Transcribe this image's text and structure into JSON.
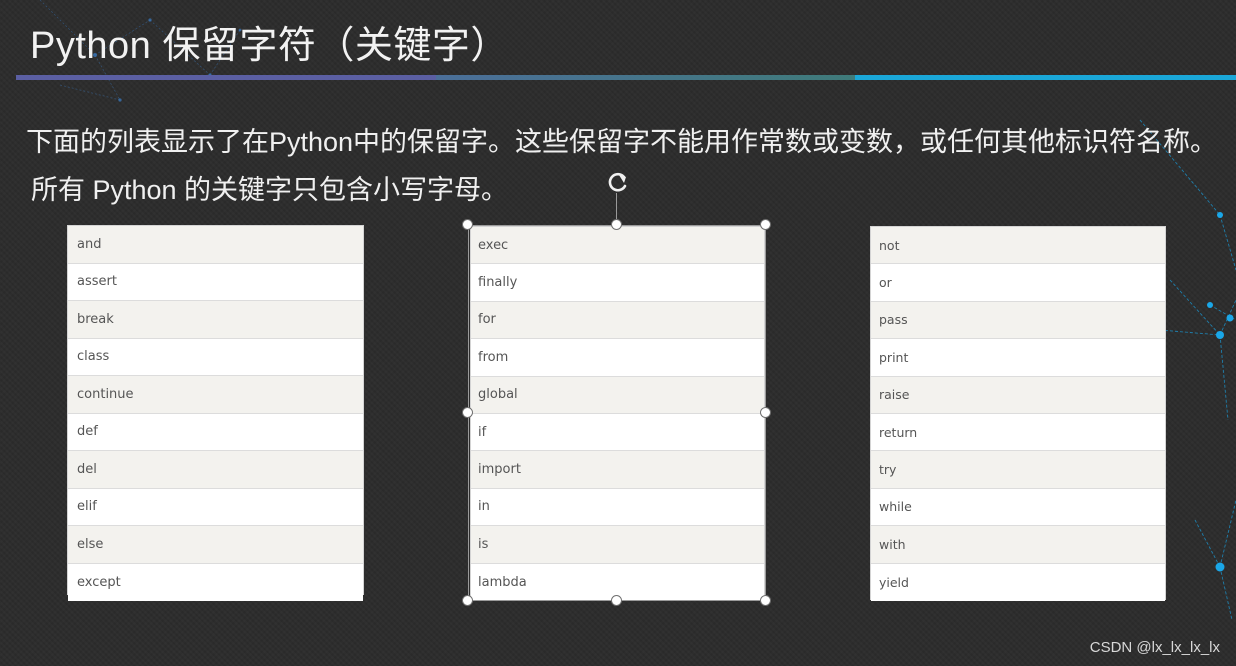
{
  "slide": {
    "title": "Python 保留字符（关键字）",
    "description_line1": "下面的列表显示了在Python中的保留字。这些保留字不能用作常数或变数，或任何其他标识符名称。",
    "description_line2": "所有 Python 的关键字只包含小写字母。"
  },
  "tables": {
    "column1": [
      "and",
      "assert",
      "break",
      "class",
      "continue",
      "def",
      "del",
      "elif",
      "else",
      "except"
    ],
    "column2": [
      "exec",
      "finally",
      "for",
      "from",
      "global",
      "if",
      "import",
      "in",
      "is",
      "lambda"
    ],
    "column3": [
      "not",
      "or",
      "pass",
      "print",
      "raise",
      "return",
      "try",
      "while",
      "with",
      "yield"
    ]
  },
  "watermark": "CSDN @lx_lx_lx_lx",
  "icons": {
    "rotate": "rotate-handle-icon"
  },
  "colors": {
    "background": "#2c2c2c",
    "title_bar_purple": "#5b5fa3",
    "title_bar_teal": "#3f7b7a",
    "title_bar_cyan": "#1aa7d8",
    "row_shaded": "#f3f2ee",
    "row_white": "#ffffff"
  }
}
